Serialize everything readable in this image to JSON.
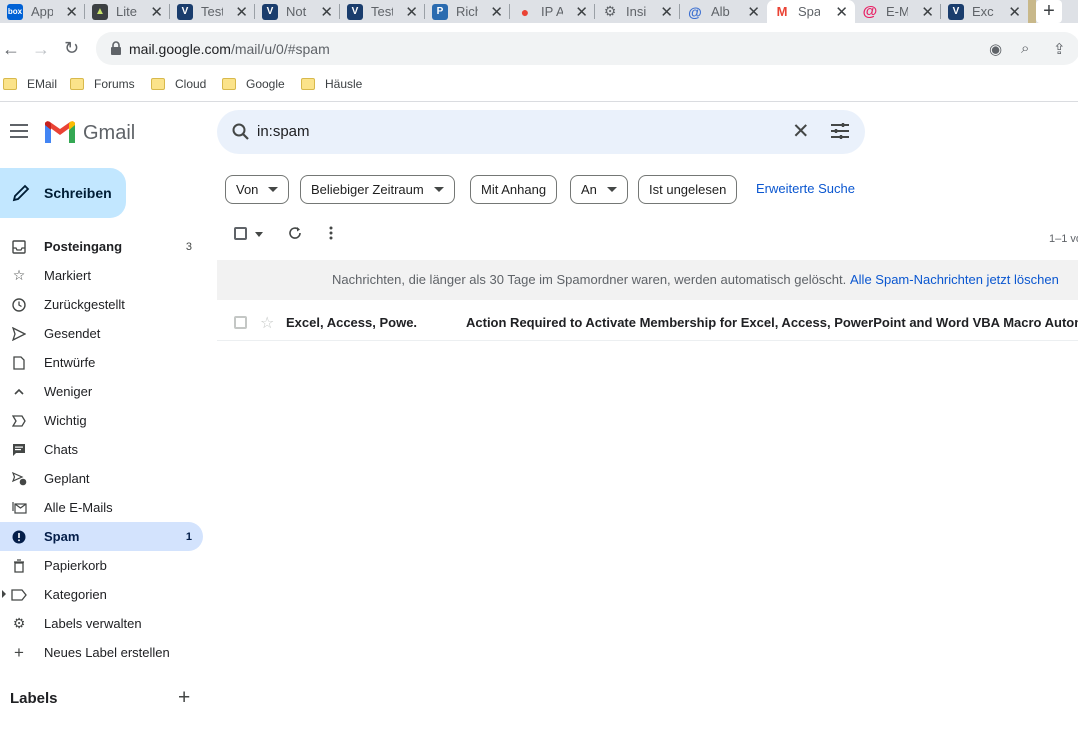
{
  "browser": {
    "tabs": [
      {
        "title": "App",
        "icon": "box-icon",
        "color": "#0061d5"
      },
      {
        "title": "Lite",
        "icon": "witch-hat-icon",
        "color": "#3c4043"
      },
      {
        "title": "Test",
        "icon": "v-logo-icon",
        "color": "#1a3d6d"
      },
      {
        "title": "Not",
        "icon": "v-logo-icon",
        "color": "#1a3d6d"
      },
      {
        "title": "Test",
        "icon": "v-logo-icon",
        "color": "#1a3d6d"
      },
      {
        "title": "Rich",
        "icon": "p-logo-icon",
        "color": "#2b6cb0"
      },
      {
        "title": "IP A",
        "icon": "map-pin-icon",
        "color": "#34a853"
      },
      {
        "title": "Insi",
        "icon": "gear-logo-icon",
        "color": "#5f6368"
      },
      {
        "title": "Alb",
        "icon": "at-circle-icon",
        "color": "#3b6fd1"
      },
      {
        "title": "Spa",
        "icon": "gmail-icon",
        "color": "#ea4335"
      },
      {
        "title": "E-M",
        "icon": "at-icon",
        "color": "#e91e63"
      },
      {
        "title": "Exc",
        "icon": "v-logo-icon",
        "color": "#1a3d6d"
      }
    ],
    "url_host": "mail.google.com",
    "url_path": "/mail/u/0/#spam",
    "bookmarks": [
      "EMail",
      "Forums",
      "Cloud",
      "Google",
      "Häusle"
    ]
  },
  "gmail": {
    "brand": "Gmail",
    "search_query": "in:spam",
    "compose_label": "Schreiben",
    "nav": [
      {
        "label": "Posteingang",
        "count": "3",
        "icon": "inbox-icon",
        "bold": true
      },
      {
        "label": "Markiert",
        "count": "",
        "icon": "star-icon"
      },
      {
        "label": "Zurückgestellt",
        "count": "",
        "icon": "clock-icon"
      },
      {
        "label": "Gesendet",
        "count": "",
        "icon": "send-icon"
      },
      {
        "label": "Entwürfe",
        "count": "",
        "icon": "draft-icon"
      },
      {
        "label": "Weniger",
        "count": "",
        "icon": "chevron-up-icon"
      },
      {
        "label": "Wichtig",
        "count": "",
        "icon": "important-icon"
      },
      {
        "label": "Chats",
        "count": "",
        "icon": "chat-icon"
      },
      {
        "label": "Geplant",
        "count": "",
        "icon": "scheduled-icon"
      },
      {
        "label": "Alle E-Mails",
        "count": "",
        "icon": "all-mail-icon"
      },
      {
        "label": "Spam",
        "count": "1",
        "icon": "spam-icon",
        "active": true
      },
      {
        "label": "Papierkorb",
        "count": "",
        "icon": "trash-icon"
      },
      {
        "label": "Kategorien",
        "count": "",
        "icon": "label-icon",
        "caret": true
      },
      {
        "label": "Labels verwalten",
        "count": "",
        "icon": "gear-icon"
      },
      {
        "label": "Neues Label erstellen",
        "count": "",
        "icon": "plus-icon"
      }
    ],
    "labels_heading": "Labels",
    "filters": [
      "Von",
      "Beliebiger Zeitraum",
      "Mit Anhang",
      "An",
      "Ist ungelesen"
    ],
    "advanced_search": "Erweiterte Suche",
    "range": "1–1 vo",
    "spam_notice": "Nachrichten, die länger als 30 Tage im Spamordner waren, werden automatisch gelöscht.",
    "delete_all_link": "Alle Spam-Nachrichten jetzt löschen",
    "messages": [
      {
        "sender": "Excel, Access, Powe.",
        "subject": "Action Required to Activate Membership for Excel, Access, PowerPoint and Word VBA Macro Automati"
      }
    ]
  }
}
